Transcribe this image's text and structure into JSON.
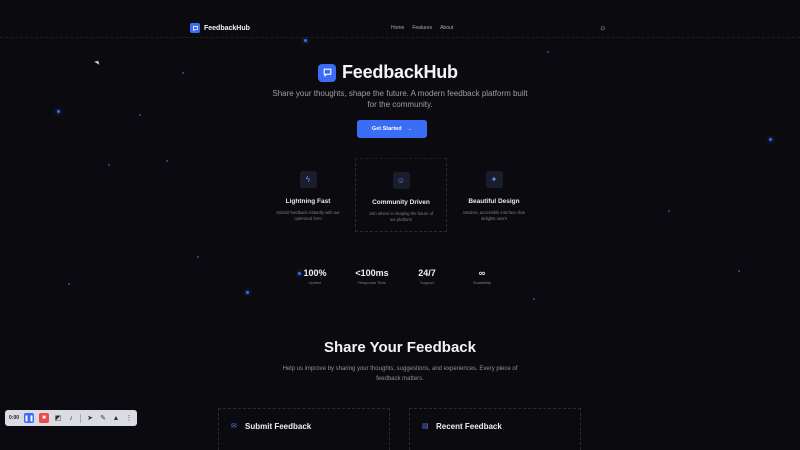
{
  "nav": {
    "brand": "FeedbackHub",
    "links": [
      "Home",
      "Features",
      "About"
    ],
    "theme_icon": "sun-icon"
  },
  "hero": {
    "title": "FeedbackHub",
    "subtitle": "Share your thoughts, shape the future. A modern feedback platform built for the community.",
    "cta": "Get Started",
    "cta_icon": "arrow-right-icon"
  },
  "features": [
    {
      "icon": "lightning-icon",
      "title": "Lightning Fast",
      "desc": "Submit feedback instantly with our optimized form"
    },
    {
      "icon": "users-icon",
      "title": "Community Driven",
      "desc": "Join others in shaping the future of our platform"
    },
    {
      "icon": "sparkles-icon",
      "title": "Beautiful Design",
      "desc": "Modern, accessible interface that delights users"
    }
  ],
  "stats": [
    {
      "value": "100%",
      "label": "Uptime"
    },
    {
      "value": "<100ms",
      "label": "Response Time"
    },
    {
      "value": "24/7",
      "label": "Support"
    },
    {
      "value": "∞",
      "label": "Scalability"
    }
  ],
  "section": {
    "title": "Share Your Feedback",
    "subtitle": "Help us improve by sharing your thoughts, suggestions, and experiences. Every piece of feedback matters."
  },
  "panels": [
    {
      "icon": "message-icon",
      "title": "Submit Feedback"
    },
    {
      "icon": "document-icon",
      "title": "Recent Feedback"
    }
  ],
  "toolbar": {
    "time": "0:00"
  },
  "colors": {
    "accent": "#3b6cf6",
    "background": "#0b0b0f"
  }
}
